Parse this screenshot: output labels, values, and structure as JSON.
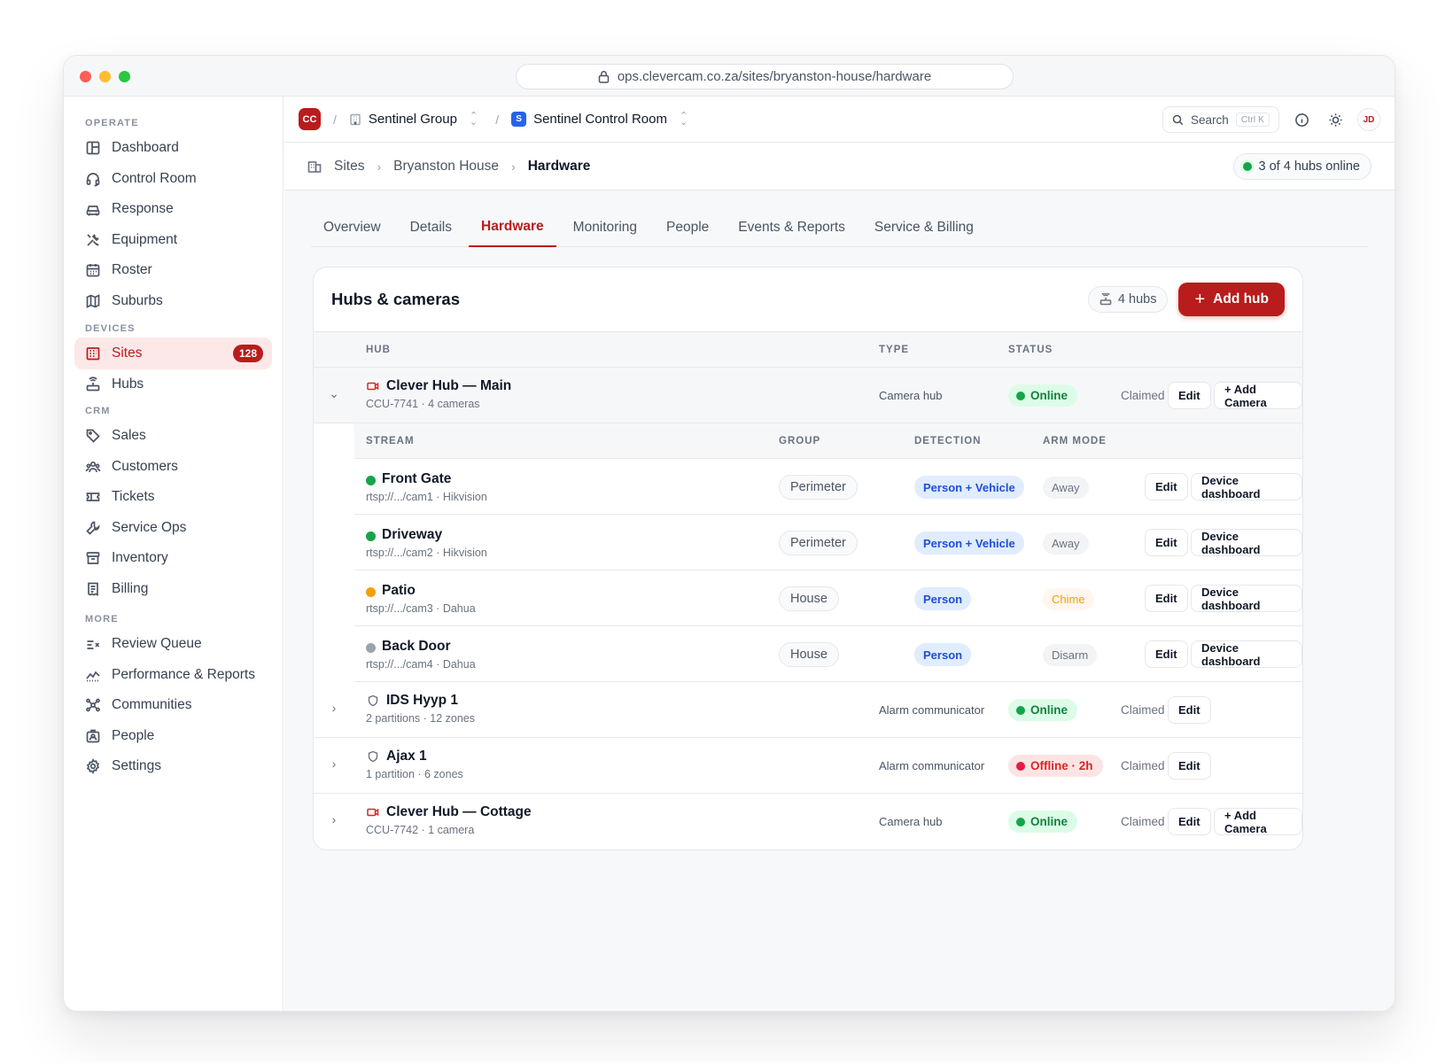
{
  "browser": {
    "url": "ops.clevercam.co.za/sites/bryanston-house/hardware"
  },
  "sidebar": {
    "sections": [
      {
        "title": "OPERATE",
        "items": [
          {
            "label": "Dashboard",
            "icon": "dashboard-icon"
          },
          {
            "label": "Control Room",
            "icon": "headset-icon"
          },
          {
            "label": "Response",
            "icon": "car-icon"
          },
          {
            "label": "Equipment",
            "icon": "tools-icon"
          },
          {
            "label": "Roster",
            "icon": "calendar-icon"
          },
          {
            "label": "Suburbs",
            "icon": "map-icon"
          }
        ]
      },
      {
        "title": "DEVICES",
        "items": [
          {
            "label": "Sites",
            "icon": "building-icon",
            "active": true,
            "badge": "128"
          },
          {
            "label": "Hubs",
            "icon": "router-icon"
          }
        ]
      },
      {
        "title": "CRM",
        "items": [
          {
            "label": "Sales",
            "icon": "tag-icon"
          },
          {
            "label": "Customers",
            "icon": "users-icon"
          },
          {
            "label": "Tickets",
            "icon": "ticket-icon"
          },
          {
            "label": "Service Ops",
            "icon": "wrench-icon"
          },
          {
            "label": "Inventory",
            "icon": "archive-icon"
          },
          {
            "label": "Billing",
            "icon": "receipt-icon"
          }
        ]
      },
      {
        "title": "MORE",
        "items": [
          {
            "label": "Review Queue",
            "icon": "review-icon"
          },
          {
            "label": "Performance & Reports",
            "icon": "trend-icon"
          },
          {
            "label": "Communities",
            "icon": "network-icon"
          },
          {
            "label": "People",
            "icon": "contact-icon"
          },
          {
            "label": "Settings",
            "icon": "settings-icon"
          }
        ]
      }
    ]
  },
  "topbar": {
    "logo": "CC",
    "org": "Sentinel Group",
    "room_badge": "S",
    "room": "Sentinel Control Room",
    "search_label": "Search",
    "search_kbd": "Ctrl K",
    "avatar": "JD"
  },
  "breadcrumb": {
    "items": [
      "Sites",
      "Bryanston House",
      "Hardware"
    ],
    "hubs_online": "3 of 4 hubs online"
  },
  "tabs": [
    {
      "label": "Overview"
    },
    {
      "label": "Details"
    },
    {
      "label": "Hardware",
      "active": true
    },
    {
      "label": "Monitoring"
    },
    {
      "label": "People"
    },
    {
      "label": "Events & Reports"
    },
    {
      "label": "Service & Billing"
    }
  ],
  "card": {
    "title": "Hubs & cameras",
    "hub_count": "4 hubs",
    "add_hub": "Add hub",
    "columns": {
      "hub": "HUB",
      "type": "TYPE",
      "status": "STATUS"
    },
    "stream_columns": {
      "stream": "STREAM",
      "group": "GROUP",
      "detection": "DETECTION",
      "arm": "ARM MODE"
    },
    "edit_label": "Edit",
    "add_camera_label": "+ Add Camera",
    "device_dashboard_label": "Device dashboard",
    "claimed_label": "Claimed"
  },
  "hubs": [
    {
      "name": "Clever Hub — Main",
      "sub": "CCU-7741 · 4 cameras",
      "type": "Camera hub",
      "status": "Online",
      "status_kind": "online",
      "kind": "camera",
      "expanded": true,
      "cameras": [
        {
          "name": "Front Gate",
          "sub": "rtsp://.../cam1 · Hikvision",
          "dot": "#16a34a",
          "group": "Perimeter",
          "detection": "Person + Vehicle",
          "arm": "Away",
          "arm_kind": "away"
        },
        {
          "name": "Driveway",
          "sub": "rtsp://.../cam2 · Hikvision",
          "dot": "#16a34a",
          "group": "Perimeter",
          "detection": "Person + Vehicle",
          "arm": "Away",
          "arm_kind": "away"
        },
        {
          "name": "Patio",
          "sub": "rtsp://.../cam3 · Dahua",
          "dot": "#f59e0b",
          "group": "House",
          "detection": "Person",
          "arm": "Chime",
          "arm_kind": "chime"
        },
        {
          "name": "Back Door",
          "sub": "rtsp://.../cam4 · Dahua",
          "dot": "#9ca3af",
          "group": "House",
          "detection": "Person",
          "arm": "Disarm",
          "arm_kind": "disarm"
        }
      ]
    },
    {
      "name": "IDS Hyyp 1",
      "sub": "2 partitions · 12 zones",
      "type": "Alarm communicator",
      "status": "Online",
      "status_kind": "online",
      "kind": "alarm"
    },
    {
      "name": "Ajax 1",
      "sub": "1 partition · 6 zones",
      "type": "Alarm communicator",
      "status": "Offline · 2h",
      "status_kind": "offline",
      "kind": "alarm"
    },
    {
      "name": "Clever Hub — Cottage",
      "sub": "CCU-7742 · 1 camera",
      "type": "Camera hub",
      "status": "Online",
      "status_kind": "online",
      "kind": "camera"
    }
  ]
}
